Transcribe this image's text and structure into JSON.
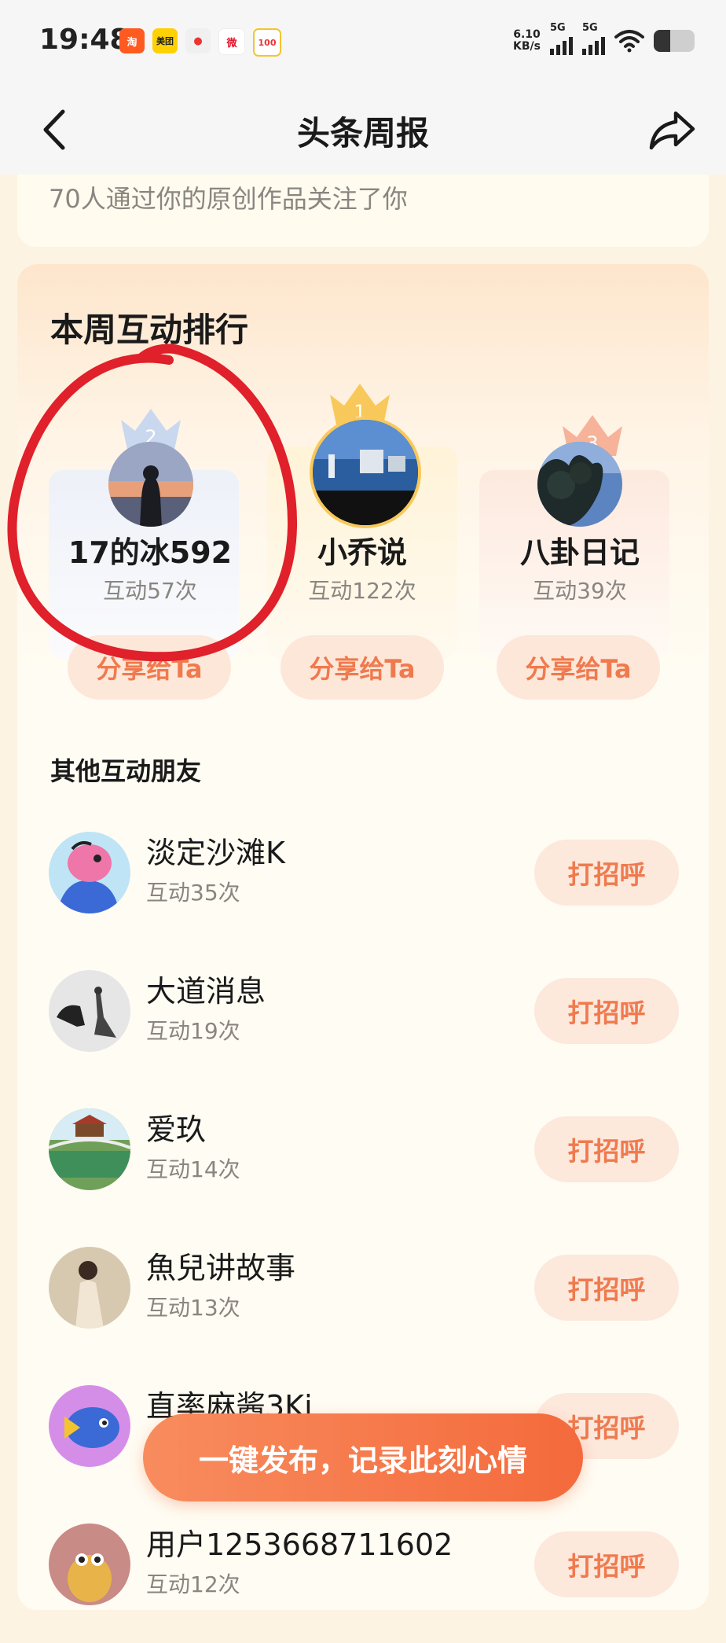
{
  "status_bar": {
    "time": "19:48",
    "apps": [
      {
        "label": "淘",
        "color": "#ff5a1f"
      },
      {
        "label": "美团",
        "color": "#ffd100"
      },
      {
        "label": "●",
        "color": "#e8e8e8"
      },
      {
        "label": "微",
        "color": "#e6162d"
      },
      {
        "label": "100",
        "color": "#f4c430"
      }
    ],
    "net_speed": "6.10",
    "net_unit": "KB/s",
    "signal_1_label": "5G",
    "signal_2_label": "5G",
    "battery_level": 0.4
  },
  "nav": {
    "title": "头条周报"
  },
  "top_card": {
    "text": "70人通过你的原创作品关注了你"
  },
  "ranking": {
    "title": "本周互动排行",
    "top": [
      {
        "rank": "1",
        "name": "小乔说",
        "count": "互动122次",
        "share": "分享给Ta"
      },
      {
        "rank": "2",
        "name": "17的冰592",
        "count": "互动57次",
        "share": "分享给Ta"
      },
      {
        "rank": "3",
        "name": "八卦日记",
        "count": "互动39次",
        "share": "分享给Ta"
      }
    ]
  },
  "others": {
    "title": "其他互动朋友",
    "friends": [
      {
        "name": "淡定沙滩K",
        "count": "互动35次",
        "button": "打招呼"
      },
      {
        "name": "大道消息",
        "count": "互动19次",
        "button": "打招呼"
      },
      {
        "name": "爱玖",
        "count": "互动14次",
        "button": "打招呼"
      },
      {
        "name": "魚兒讲故事",
        "count": "互动13次",
        "button": "打招呼"
      },
      {
        "name": "直率麻酱3Ki",
        "count": "",
        "button": "打招呼"
      },
      {
        "name": "用户1253668711602",
        "count": "互动12次",
        "button": "打招呼"
      }
    ]
  },
  "publish_button": "一键发布，记录此刻心情",
  "colors": {
    "accent": "#ef7a4e",
    "button_bg": "#fde8dc",
    "annotation": "#e0202a"
  }
}
